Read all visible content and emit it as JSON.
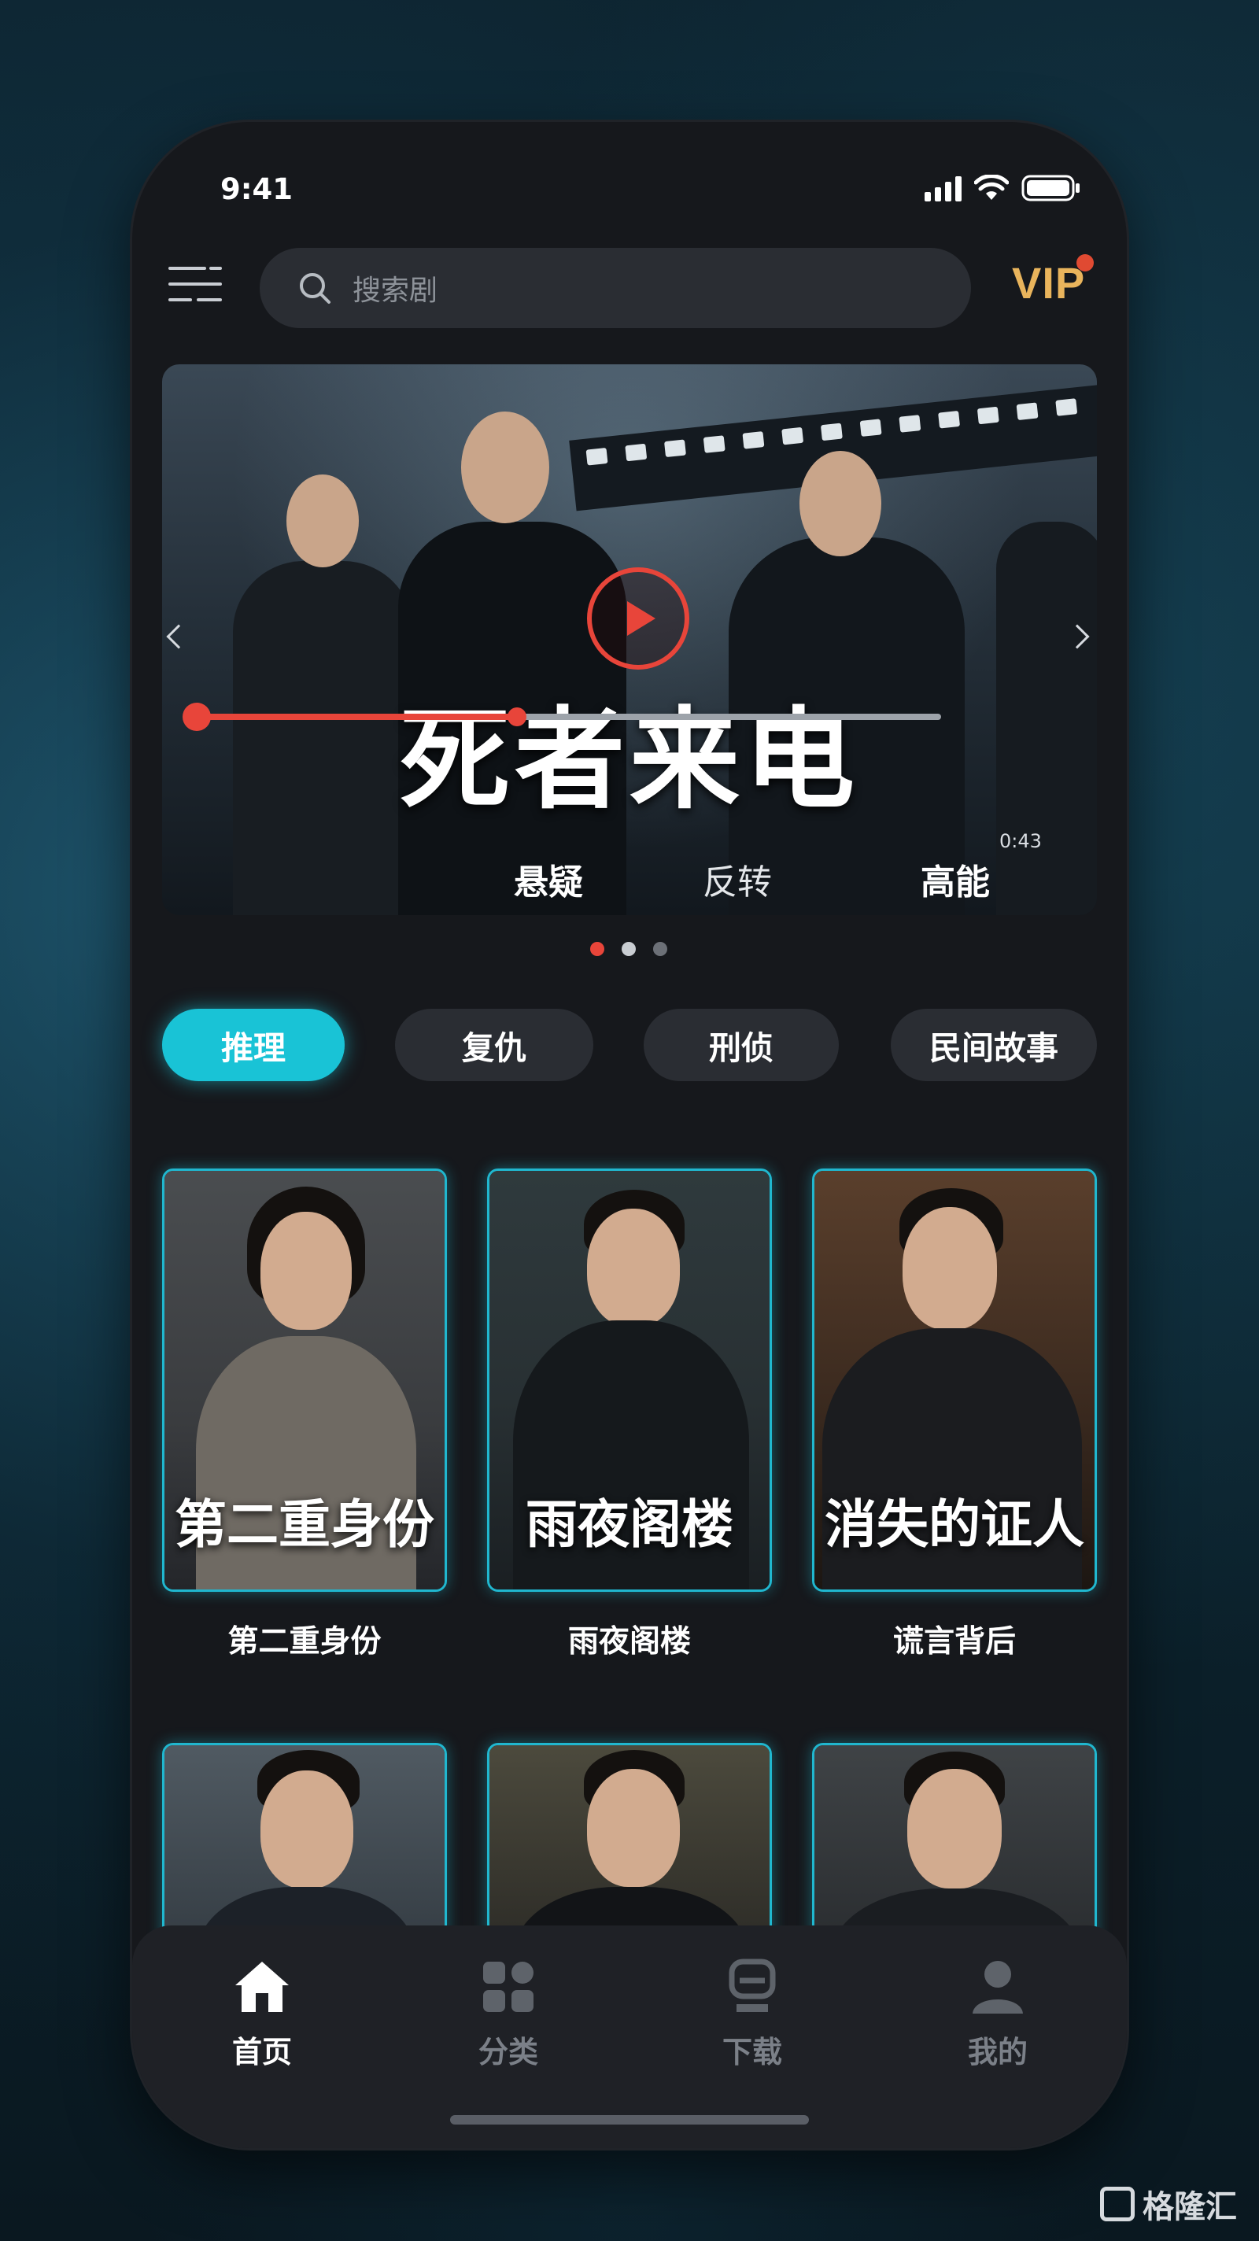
{
  "status_bar": {
    "time": "9:41"
  },
  "header": {
    "search_placeholder": "搜索剧",
    "vip_label": "VIP"
  },
  "banner": {
    "title": "死者来电",
    "progress_time": "0:43",
    "progress_fraction": 0.43,
    "tags": [
      "悬疑",
      "反转",
      "高能"
    ],
    "page_count": 3,
    "active_page": 0
  },
  "categories": [
    {
      "label": "推理",
      "active": true
    },
    {
      "label": "复仇",
      "active": false
    },
    {
      "label": "刑侦",
      "active": false
    },
    {
      "label": "民间故事",
      "active": false
    }
  ],
  "dramas": [
    {
      "poster_title": "第二重身份",
      "label": "第二重身份"
    },
    {
      "poster_title": "雨夜阁楼",
      "label": "雨夜阁楼"
    },
    {
      "poster_title": "消失的证人",
      "label": "谎言背后"
    }
  ],
  "tabbar": [
    {
      "label": "首页",
      "icon": "home-icon",
      "active": true
    },
    {
      "label": "分类",
      "icon": "grid-icon",
      "active": false
    },
    {
      "label": "下载",
      "icon": "download-icon",
      "active": false
    },
    {
      "label": "我的",
      "icon": "user-icon",
      "active": false
    }
  ],
  "watermark": "格隆汇",
  "colors": {
    "accent": "#19c3d6",
    "play_red": "#e8453a",
    "vip_gold": "#e9b45c"
  }
}
